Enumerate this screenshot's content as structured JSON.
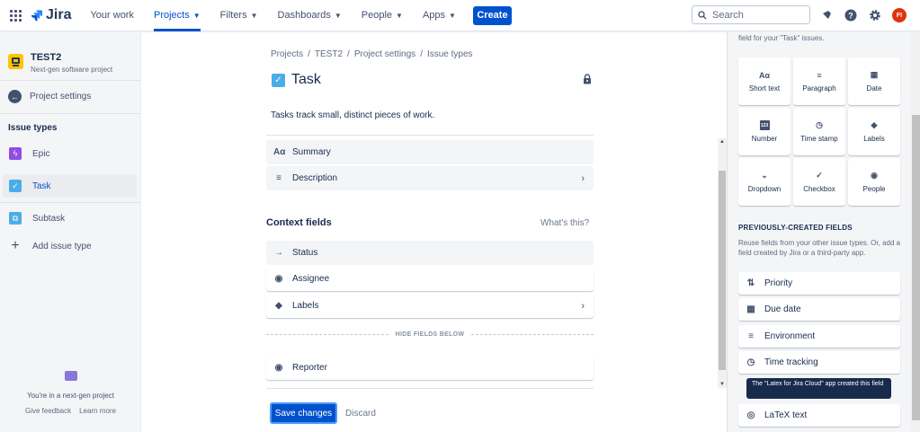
{
  "topbar": {
    "logo_text": "Jira",
    "nav": [
      {
        "label": "Your work",
        "has_caret": false
      },
      {
        "label": "Projects",
        "has_caret": true,
        "active": true
      },
      {
        "label": "Filters",
        "has_caret": true
      },
      {
        "label": "Dashboards",
        "has_caret": true
      },
      {
        "label": "People",
        "has_caret": true
      },
      {
        "label": "Apps",
        "has_caret": true
      }
    ],
    "create_label": "Create",
    "search_placeholder": "Search",
    "avatar_initials": "FI",
    "brand_color": "#0052cc"
  },
  "sidebar": {
    "project_name": "TEST2",
    "project_type": "Next-gen software project",
    "back_label": "Project settings",
    "section_heading": "Issue types",
    "items": [
      {
        "label": "Epic",
        "color": "#904ee2"
      },
      {
        "label": "Task",
        "color": "#4bade8",
        "active": true
      },
      {
        "label": "Subtask",
        "color": "#4bade8"
      }
    ],
    "add_label": "Add issue type",
    "footer_text": "You're in a next-gen project",
    "footer_links": [
      "Give feedback",
      "Learn more"
    ]
  },
  "main": {
    "breadcrumb": [
      "Projects",
      "/",
      "TEST2",
      "/",
      "Project settings",
      "/",
      "Issue types"
    ],
    "title": "Task",
    "description": "Tasks track small, distinct pieces of work.",
    "description_fields": [
      {
        "label": "Summary",
        "icon": "Aα"
      },
      {
        "label": "Description",
        "icon": "≡",
        "chevron": true
      }
    ],
    "context_heading": "Context fields",
    "whats_this": "What's this?",
    "context_fields": [
      {
        "label": "Status",
        "icon": "→"
      },
      {
        "label": "Assignee",
        "icon": "◉"
      },
      {
        "label": "Labels",
        "icon": "◆",
        "chevron": true
      }
    ],
    "hide_fields_label": "HIDE FIELDS BELOW",
    "hidden_fields": [
      {
        "label": "Reporter",
        "icon": "◉"
      }
    ],
    "save_label": "Save changes",
    "discard_label": "Discard"
  },
  "right_panel": {
    "top_text": "field for your \"Task\" issues.",
    "tiles": [
      {
        "label": "Short text",
        "icon": "Aα"
      },
      {
        "label": "Paragraph",
        "icon": "≡"
      },
      {
        "label": "Date",
        "icon": "▦"
      },
      {
        "label": "Number",
        "icon": "123"
      },
      {
        "label": "Time stamp",
        "icon": "◷"
      },
      {
        "label": "Labels",
        "icon": "◆"
      },
      {
        "label": "Dropdown",
        "icon": "⌄"
      },
      {
        "label": "Checkbox",
        "icon": "✓"
      },
      {
        "label": "People",
        "icon": "◉"
      }
    ],
    "previous_heading": "PREVIOUSLY-CREATED FIELDS",
    "previous_desc": "Reuse fields from your other issue types. Or, add a field created by Jira or a third-party app.",
    "previous_fields": [
      {
        "label": "Priority",
        "icon": "⇅"
      },
      {
        "label": "Due date",
        "icon": "▦"
      },
      {
        "label": "Environment",
        "icon": "≡"
      },
      {
        "label": "Time tracking",
        "icon": "◷"
      },
      {
        "label": "LaTeX text",
        "icon": "◎"
      }
    ],
    "tooltip": "The \"Latex for Jira Cloud\" app created this field"
  }
}
